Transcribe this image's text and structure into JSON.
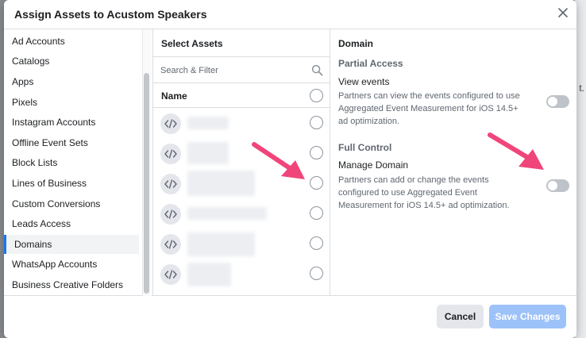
{
  "dialog": {
    "title": "Assign Assets to Acustom Speakers",
    "background_hint": "t."
  },
  "categories": [
    {
      "label": "Ad Accounts"
    },
    {
      "label": "Catalogs"
    },
    {
      "label": "Apps"
    },
    {
      "label": "Pixels"
    },
    {
      "label": "Instagram Accounts"
    },
    {
      "label": "Offline Event Sets"
    },
    {
      "label": "Block Lists"
    },
    {
      "label": "Lines of Business"
    },
    {
      "label": "Custom Conversions"
    },
    {
      "label": "Leads Access"
    },
    {
      "label": "Domains",
      "active": true
    },
    {
      "label": "WhatsApp Accounts"
    },
    {
      "label": "Business Creative Folders"
    }
  ],
  "assets": {
    "heading": "Select Assets",
    "search_placeholder": "Search & Filter",
    "name_header": "Name",
    "rows_count_note": "6 domain rows with blurred names"
  },
  "panel": {
    "heading": "Domain",
    "partial_access": "Partial Access",
    "view_events_label": "View events",
    "view_events_desc": "Partners can view the events configured to use Aggregated Event Measurement for iOS 14.5+ ad optimization.",
    "full_control": "Full Control",
    "manage_domain_label": "Manage Domain",
    "manage_domain_desc": "Partners can add or change the events configured to use Aggregated Event Measurement for iOS 14.5+ ad optimization.",
    "view_events_on": false,
    "manage_domain_on": false
  },
  "footer": {
    "cancel_label": "Cancel",
    "save_label": "Save Changes"
  },
  "colors": {
    "accent": "#1877f2",
    "arrow": "#f0457b",
    "save_disabled": "#9cc2f9"
  }
}
